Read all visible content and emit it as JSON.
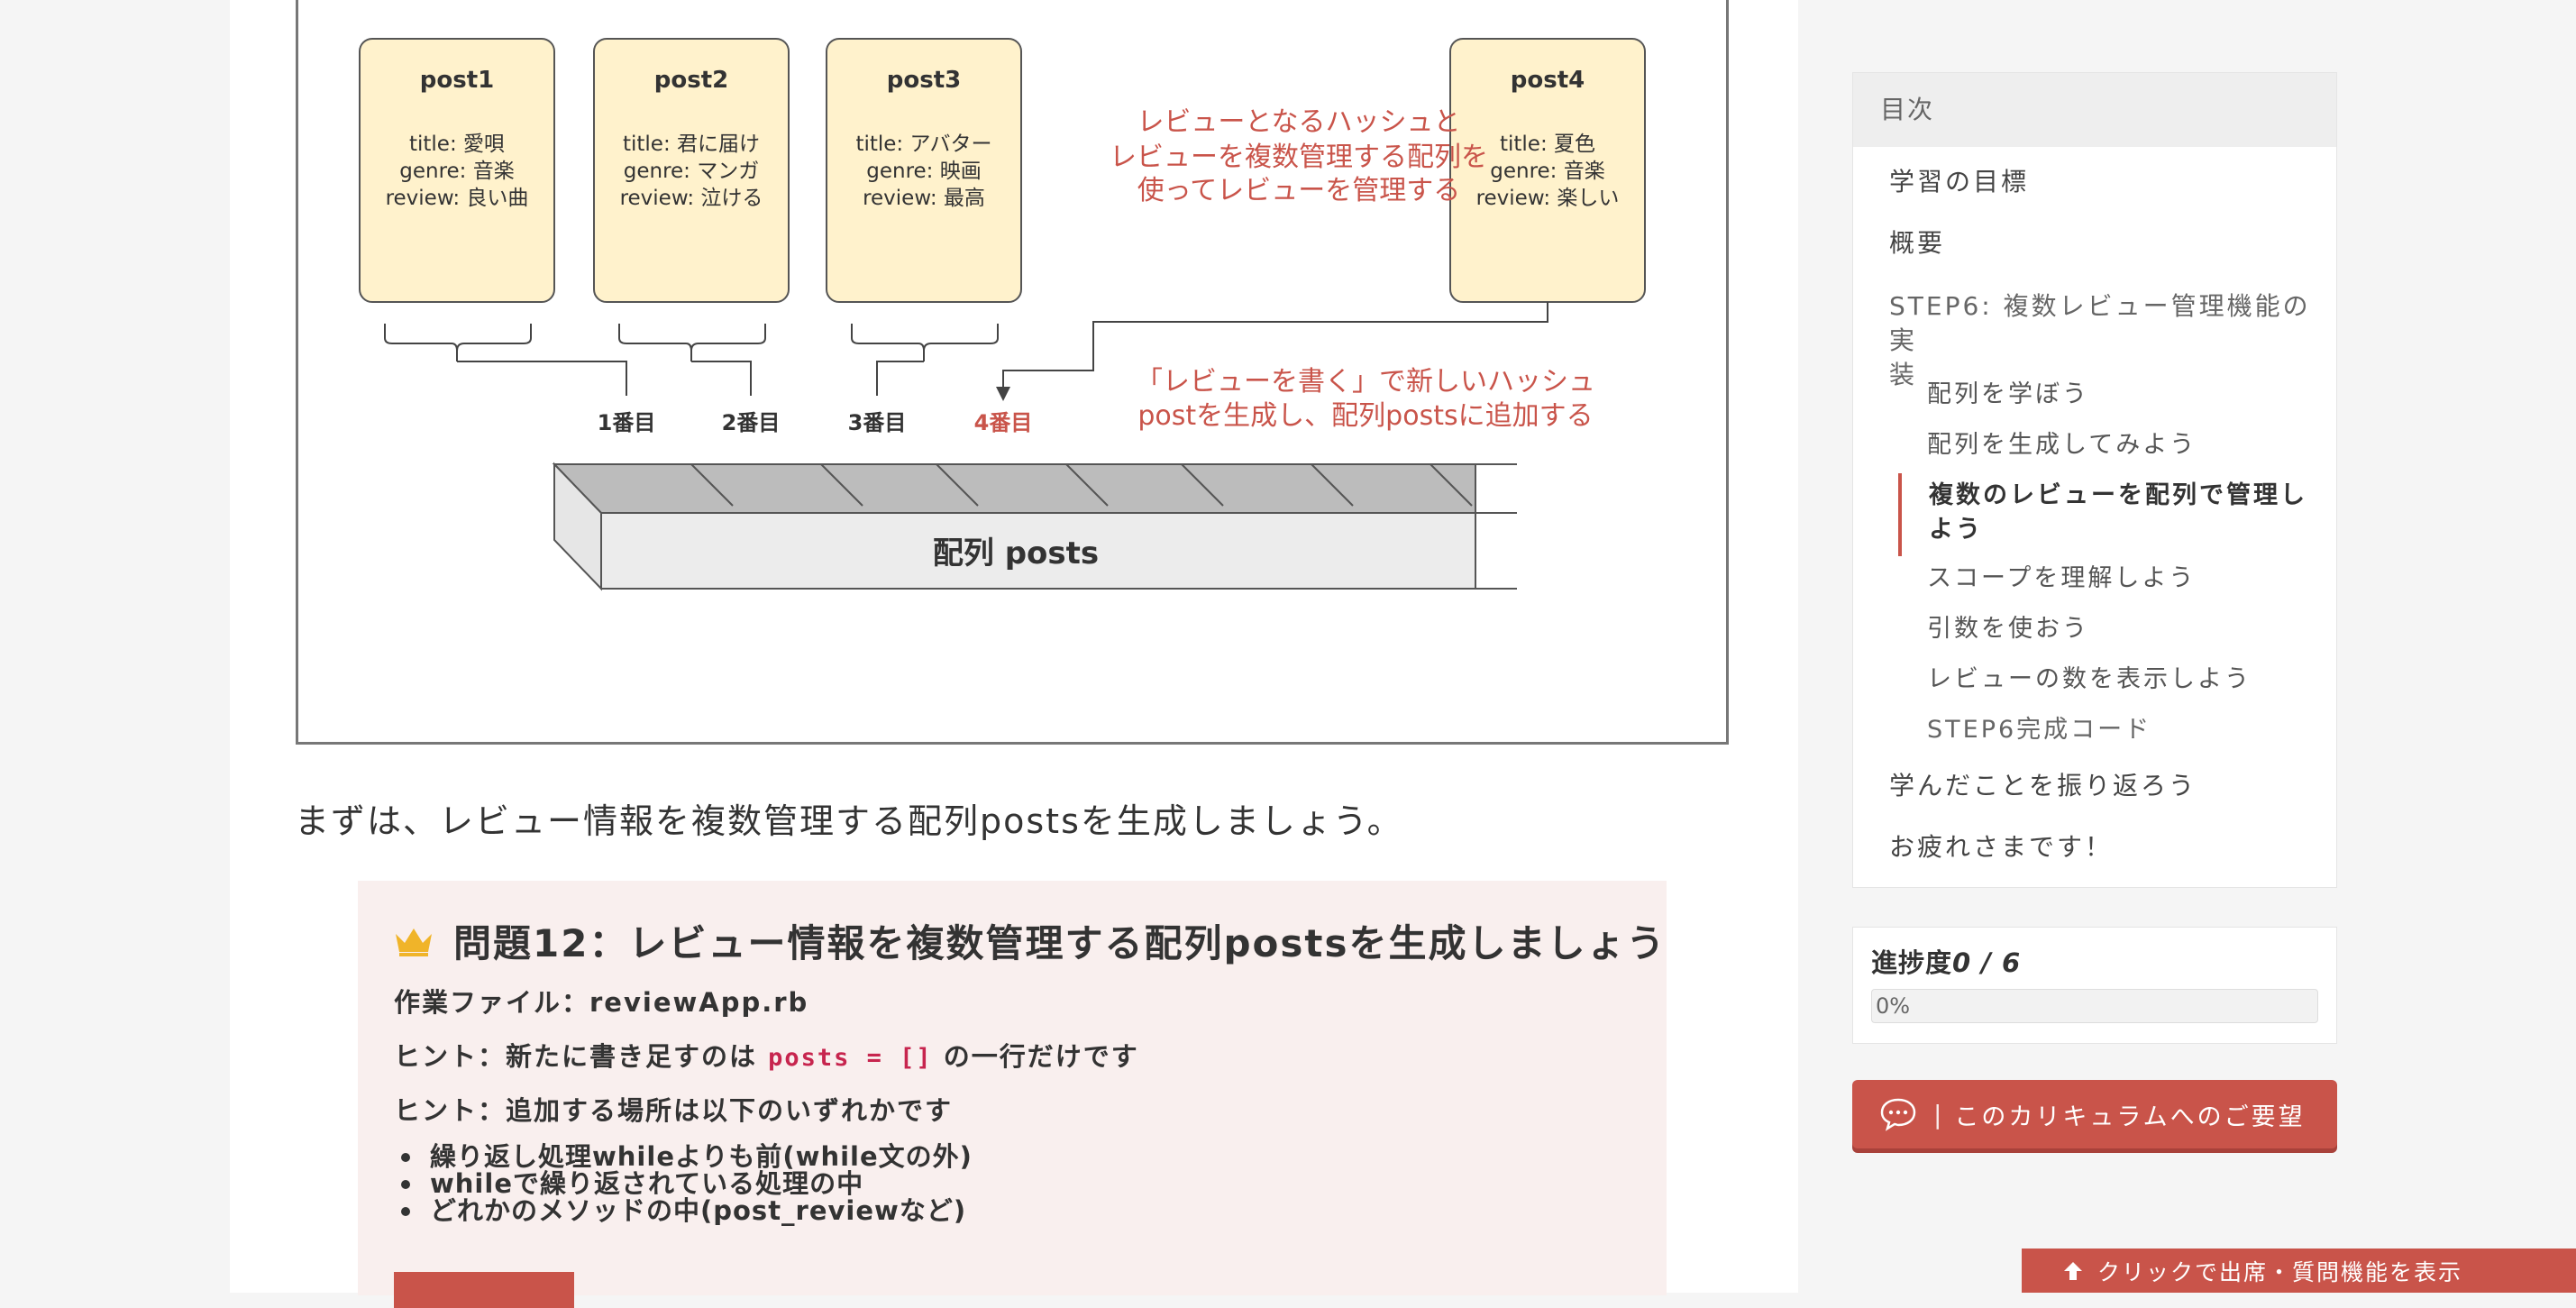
{
  "diagram": {
    "posts": [
      {
        "name": "post1",
        "title": "title: 愛唄",
        "genre": "genre: 音楽",
        "review": "review: 良い曲"
      },
      {
        "name": "post2",
        "title": "title: 君に届け",
        "genre": "genre: マンガ",
        "review": "review: 泣ける"
      },
      {
        "name": "post3",
        "title": "title: アバター",
        "genre": "genre: 映画",
        "review": "review: 最高"
      },
      {
        "name": "post4",
        "title": "title: 夏色",
        "genre": "genre: 音楽",
        "review": "review: 楽しい"
      }
    ],
    "note1_lines": [
      "レビューとなるハッシュと",
      "レビューを複数管理する配列を",
      "使ってレビューを管理する"
    ],
    "note2_lines": [
      "「レビューを書く」で新しいハッシュ",
      "postを生成し、配列postsに追加する"
    ],
    "indices": [
      "1番目",
      "2番目",
      "3番目",
      "4番目"
    ],
    "array_label": "配列 posts"
  },
  "intro_text": "まずは、レビュー情報を複数管理する配列postsを生成しましょう。",
  "problem": {
    "title": "問題12：レビュー情報を複数管理する配列postsを生成しましょう",
    "file": "作業ファイル：reviewApp.rb",
    "hint1_prefix": "ヒント：新たに書き足すのは ",
    "hint1_code": "posts = []",
    "hint1_suffix": " の一行だけです",
    "hint2": "ヒント：追加する場所は以下のいずれかです",
    "options": [
      "繰り返し処理whileよりも前(while文の外)",
      "whileで繰り返されている処理の中",
      "どれかのメソッドの中(post_reviewなど)"
    ]
  },
  "toc": {
    "heading": "目次",
    "items": [
      {
        "label": "学習の目標"
      },
      {
        "label": "概要"
      },
      {
        "label_line1": "STEP6: 複数レビュー管理機能の実",
        "label_line2": "装"
      },
      {
        "label": "配列を学ぼう"
      },
      {
        "label": "配列を生成してみよう"
      },
      {
        "label_line1": "複数のレビューを配列で管理し",
        "label_line2": "よう"
      },
      {
        "label": "スコープを理解しよう"
      },
      {
        "label": "引数を使おう"
      },
      {
        "label": "レビューの数を表示しよう"
      },
      {
        "label": "STEP6完成コード"
      },
      {
        "label": "学んだことを振り返ろう"
      },
      {
        "label": "お疲れさまです！"
      }
    ]
  },
  "progress": {
    "label": "進捗度",
    "count": "0 / 6",
    "percent_text": "0%",
    "value": 0
  },
  "request_button": {
    "label": "このカリキュラムへのご要望"
  },
  "attend_bar": {
    "label": "クリックで出席・質問機能を表示"
  },
  "colors": {
    "accent": "#c9544a",
    "card": "#fff2cc",
    "problem_bg": "#f9efee"
  }
}
